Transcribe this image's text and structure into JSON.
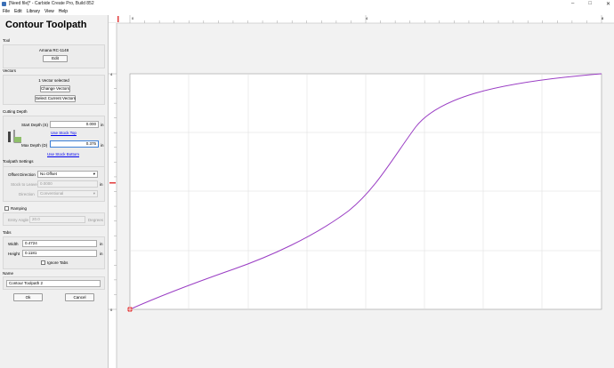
{
  "window": {
    "title": "[Need file]* - Carbide Create Pro, Build 852"
  },
  "menu": [
    "File",
    "Edit",
    "Library",
    "View",
    "Help"
  ],
  "panel": {
    "title": "Contour Toolpath",
    "tool": {
      "section": "Tool",
      "name": "Amana RC-1148",
      "edit_label": "Edit"
    },
    "vectors": {
      "section": "Vectors",
      "status": "1 Vector selected",
      "change_label": "Change Vectors",
      "select_label": "Select Current Vectors"
    },
    "depth": {
      "section": "Cutting Depth",
      "start_label": "Start Depth (S)",
      "start_value": "0.000",
      "start_unit": "in",
      "use_stock_top": "Use Stock Top",
      "max_label": "Max Depth (D)",
      "max_value": "0.375",
      "max_unit": "in",
      "use_stock_bottom": "Use Stock Bottom"
    },
    "settings": {
      "section": "Toolpath Settings",
      "offset_label": "Offset Direction",
      "offset_value": "No Offset",
      "stock_label": "Stock to Leave",
      "stock_value": "0.0000",
      "stock_unit": "in",
      "direction_label": "Direction",
      "direction_value": "Conventional"
    },
    "ramping": {
      "label": "Ramping",
      "entry_label": "Entry Angle",
      "entry_value": "20.0",
      "entry_unit": "Degrees"
    },
    "tabs": {
      "section": "Tabs",
      "width_label": "Width",
      "width_value": "0.4724",
      "width_unit": "in",
      "height_label": "Height",
      "height_value": "0.1181",
      "height_unit": "in",
      "ignore_label": "Ignore Tabs"
    },
    "name": {
      "section": "Name",
      "value": "Contour Toolpath 2"
    },
    "ok_label": "Ok",
    "cancel_label": "Cancel"
  },
  "workspace": {
    "ruler_top": [
      "0",
      "4",
      "8"
    ],
    "ruler_left": [
      "4",
      "0"
    ],
    "accent_color": "#e23b3b",
    "path_color": "#9a3ec4"
  }
}
